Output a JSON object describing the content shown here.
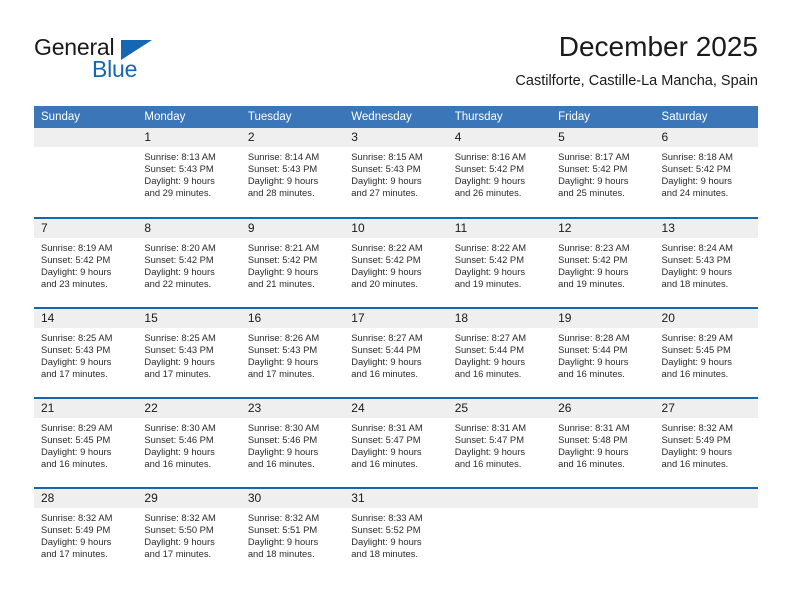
{
  "brand": {
    "name_part1": "General",
    "name_part2": "Blue",
    "accent_color": "#1667b3",
    "logo_icon": "triangle-flag-icon"
  },
  "header": {
    "title": "December 2025",
    "location": "Castilforte, Castille-La Mancha, Spain"
  },
  "calendar": {
    "header_bg": "#3a76b8",
    "row_border_color": "#1667b3",
    "daynum_bg": "#efefef",
    "weekday_headers": [
      "Sunday",
      "Monday",
      "Tuesday",
      "Wednesday",
      "Thursday",
      "Friday",
      "Saturday"
    ],
    "weeks": [
      [
        {
          "day": "",
          "lines": []
        },
        {
          "day": "1",
          "lines": [
            "Sunrise: 8:13 AM",
            "Sunset: 5:43 PM",
            "Daylight: 9 hours",
            "and 29 minutes."
          ]
        },
        {
          "day": "2",
          "lines": [
            "Sunrise: 8:14 AM",
            "Sunset: 5:43 PM",
            "Daylight: 9 hours",
            "and 28 minutes."
          ]
        },
        {
          "day": "3",
          "lines": [
            "Sunrise: 8:15 AM",
            "Sunset: 5:43 PM",
            "Daylight: 9 hours",
            "and 27 minutes."
          ]
        },
        {
          "day": "4",
          "lines": [
            "Sunrise: 8:16 AM",
            "Sunset: 5:42 PM",
            "Daylight: 9 hours",
            "and 26 minutes."
          ]
        },
        {
          "day": "5",
          "lines": [
            "Sunrise: 8:17 AM",
            "Sunset: 5:42 PM",
            "Daylight: 9 hours",
            "and 25 minutes."
          ]
        },
        {
          "day": "6",
          "lines": [
            "Sunrise: 8:18 AM",
            "Sunset: 5:42 PM",
            "Daylight: 9 hours",
            "and 24 minutes."
          ]
        }
      ],
      [
        {
          "day": "7",
          "lines": [
            "Sunrise: 8:19 AM",
            "Sunset: 5:42 PM",
            "Daylight: 9 hours",
            "and 23 minutes."
          ]
        },
        {
          "day": "8",
          "lines": [
            "Sunrise: 8:20 AM",
            "Sunset: 5:42 PM",
            "Daylight: 9 hours",
            "and 22 minutes."
          ]
        },
        {
          "day": "9",
          "lines": [
            "Sunrise: 8:21 AM",
            "Sunset: 5:42 PM",
            "Daylight: 9 hours",
            "and 21 minutes."
          ]
        },
        {
          "day": "10",
          "lines": [
            "Sunrise: 8:22 AM",
            "Sunset: 5:42 PM",
            "Daylight: 9 hours",
            "and 20 minutes."
          ]
        },
        {
          "day": "11",
          "lines": [
            "Sunrise: 8:22 AM",
            "Sunset: 5:42 PM",
            "Daylight: 9 hours",
            "and 19 minutes."
          ]
        },
        {
          "day": "12",
          "lines": [
            "Sunrise: 8:23 AM",
            "Sunset: 5:42 PM",
            "Daylight: 9 hours",
            "and 19 minutes."
          ]
        },
        {
          "day": "13",
          "lines": [
            "Sunrise: 8:24 AM",
            "Sunset: 5:43 PM",
            "Daylight: 9 hours",
            "and 18 minutes."
          ]
        }
      ],
      [
        {
          "day": "14",
          "lines": [
            "Sunrise: 8:25 AM",
            "Sunset: 5:43 PM",
            "Daylight: 9 hours",
            "and 17 minutes."
          ]
        },
        {
          "day": "15",
          "lines": [
            "Sunrise: 8:25 AM",
            "Sunset: 5:43 PM",
            "Daylight: 9 hours",
            "and 17 minutes."
          ]
        },
        {
          "day": "16",
          "lines": [
            "Sunrise: 8:26 AM",
            "Sunset: 5:43 PM",
            "Daylight: 9 hours",
            "and 17 minutes."
          ]
        },
        {
          "day": "17",
          "lines": [
            "Sunrise: 8:27 AM",
            "Sunset: 5:44 PM",
            "Daylight: 9 hours",
            "and 16 minutes."
          ]
        },
        {
          "day": "18",
          "lines": [
            "Sunrise: 8:27 AM",
            "Sunset: 5:44 PM",
            "Daylight: 9 hours",
            "and 16 minutes."
          ]
        },
        {
          "day": "19",
          "lines": [
            "Sunrise: 8:28 AM",
            "Sunset: 5:44 PM",
            "Daylight: 9 hours",
            "and 16 minutes."
          ]
        },
        {
          "day": "20",
          "lines": [
            "Sunrise: 8:29 AM",
            "Sunset: 5:45 PM",
            "Daylight: 9 hours",
            "and 16 minutes."
          ]
        }
      ],
      [
        {
          "day": "21",
          "lines": [
            "Sunrise: 8:29 AM",
            "Sunset: 5:45 PM",
            "Daylight: 9 hours",
            "and 16 minutes."
          ]
        },
        {
          "day": "22",
          "lines": [
            "Sunrise: 8:30 AM",
            "Sunset: 5:46 PM",
            "Daylight: 9 hours",
            "and 16 minutes."
          ]
        },
        {
          "day": "23",
          "lines": [
            "Sunrise: 8:30 AM",
            "Sunset: 5:46 PM",
            "Daylight: 9 hours",
            "and 16 minutes."
          ]
        },
        {
          "day": "24",
          "lines": [
            "Sunrise: 8:31 AM",
            "Sunset: 5:47 PM",
            "Daylight: 9 hours",
            "and 16 minutes."
          ]
        },
        {
          "day": "25",
          "lines": [
            "Sunrise: 8:31 AM",
            "Sunset: 5:47 PM",
            "Daylight: 9 hours",
            "and 16 minutes."
          ]
        },
        {
          "day": "26",
          "lines": [
            "Sunrise: 8:31 AM",
            "Sunset: 5:48 PM",
            "Daylight: 9 hours",
            "and 16 minutes."
          ]
        },
        {
          "day": "27",
          "lines": [
            "Sunrise: 8:32 AM",
            "Sunset: 5:49 PM",
            "Daylight: 9 hours",
            "and 16 minutes."
          ]
        }
      ],
      [
        {
          "day": "28",
          "lines": [
            "Sunrise: 8:32 AM",
            "Sunset: 5:49 PM",
            "Daylight: 9 hours",
            "and 17 minutes."
          ]
        },
        {
          "day": "29",
          "lines": [
            "Sunrise: 8:32 AM",
            "Sunset: 5:50 PM",
            "Daylight: 9 hours",
            "and 17 minutes."
          ]
        },
        {
          "day": "30",
          "lines": [
            "Sunrise: 8:32 AM",
            "Sunset: 5:51 PM",
            "Daylight: 9 hours",
            "and 18 minutes."
          ]
        },
        {
          "day": "31",
          "lines": [
            "Sunrise: 8:33 AM",
            "Sunset: 5:52 PM",
            "Daylight: 9 hours",
            "and 18 minutes."
          ]
        },
        {
          "day": "",
          "lines": []
        },
        {
          "day": "",
          "lines": []
        },
        {
          "day": "",
          "lines": []
        }
      ]
    ]
  }
}
